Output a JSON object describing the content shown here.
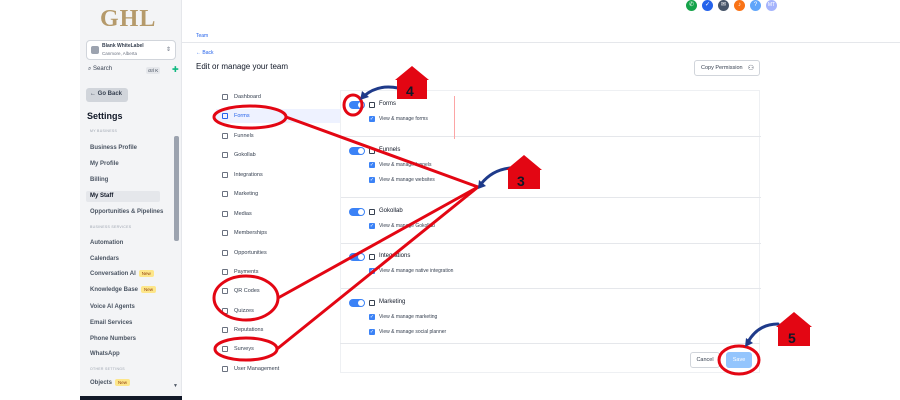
{
  "brand": {
    "logo_text": "GHL"
  },
  "account": {
    "name": "Blank WhiteLabel",
    "location": "Canmore, Alberta"
  },
  "search": {
    "label": "Search",
    "shortcut": "ctrl K"
  },
  "sidebar": {
    "go_back": "← Go Back",
    "title": "Settings",
    "groups": {
      "my_business": "MY BUSINESS",
      "business_services": "BUSINESS SERVICES",
      "other_settings": "OTHER SETTINGS"
    },
    "items": [
      {
        "label": "Business Profile"
      },
      {
        "label": "My Profile"
      },
      {
        "label": "Billing"
      },
      {
        "label": "My Staff"
      },
      {
        "label": "Opportunities & Pipelines"
      },
      {
        "label": "Automation"
      },
      {
        "label": "Calendars"
      },
      {
        "label": "Conversation AI",
        "badge": "New"
      },
      {
        "label": "Knowledge Base",
        "badge": "New"
      },
      {
        "label": "Voice AI Agents"
      },
      {
        "label": "Email Services"
      },
      {
        "label": "Phone Numbers"
      },
      {
        "label": "WhatsApp"
      },
      {
        "label": "Objects",
        "badge": "New"
      }
    ]
  },
  "header": {
    "tab": "Team",
    "back": "← Back",
    "title": "Edit or manage your team",
    "copy_permission": "Copy Permission",
    "avatar_initials": "MT"
  },
  "modules": [
    "Dashboard",
    "Forms",
    "Funnels",
    "Gokollab",
    "Integrations",
    "Marketing",
    "Medias",
    "Memberships",
    "Opportunities",
    "Payments",
    "QR Codes",
    "Quizzes",
    "Reputations",
    "Surveys",
    "User Management"
  ],
  "permissions": [
    {
      "title": "Forms",
      "items": [
        "View & manage forms"
      ]
    },
    {
      "title": "Funnels",
      "items": [
        "View & manage funnels",
        "View & manage websites"
      ]
    },
    {
      "title": "Gokollab",
      "items": [
        "View & manage Gokollab"
      ]
    },
    {
      "title": "Integrations",
      "items": [
        "View & manage native integration"
      ]
    },
    {
      "title": "Marketing",
      "items": [
        "View & manage marketing",
        "View & manage social planner"
      ]
    }
  ],
  "footer": {
    "cancel": "Cancel",
    "save": "Save"
  },
  "annotations": {
    "tag3": "3",
    "tag4": "4",
    "tag5": "5"
  },
  "colors": {
    "accent": "#3b82f6",
    "annotation_red": "#e30613",
    "arrow_blue": "#1e3a8a",
    "brand_gold": "#b59a6b"
  }
}
